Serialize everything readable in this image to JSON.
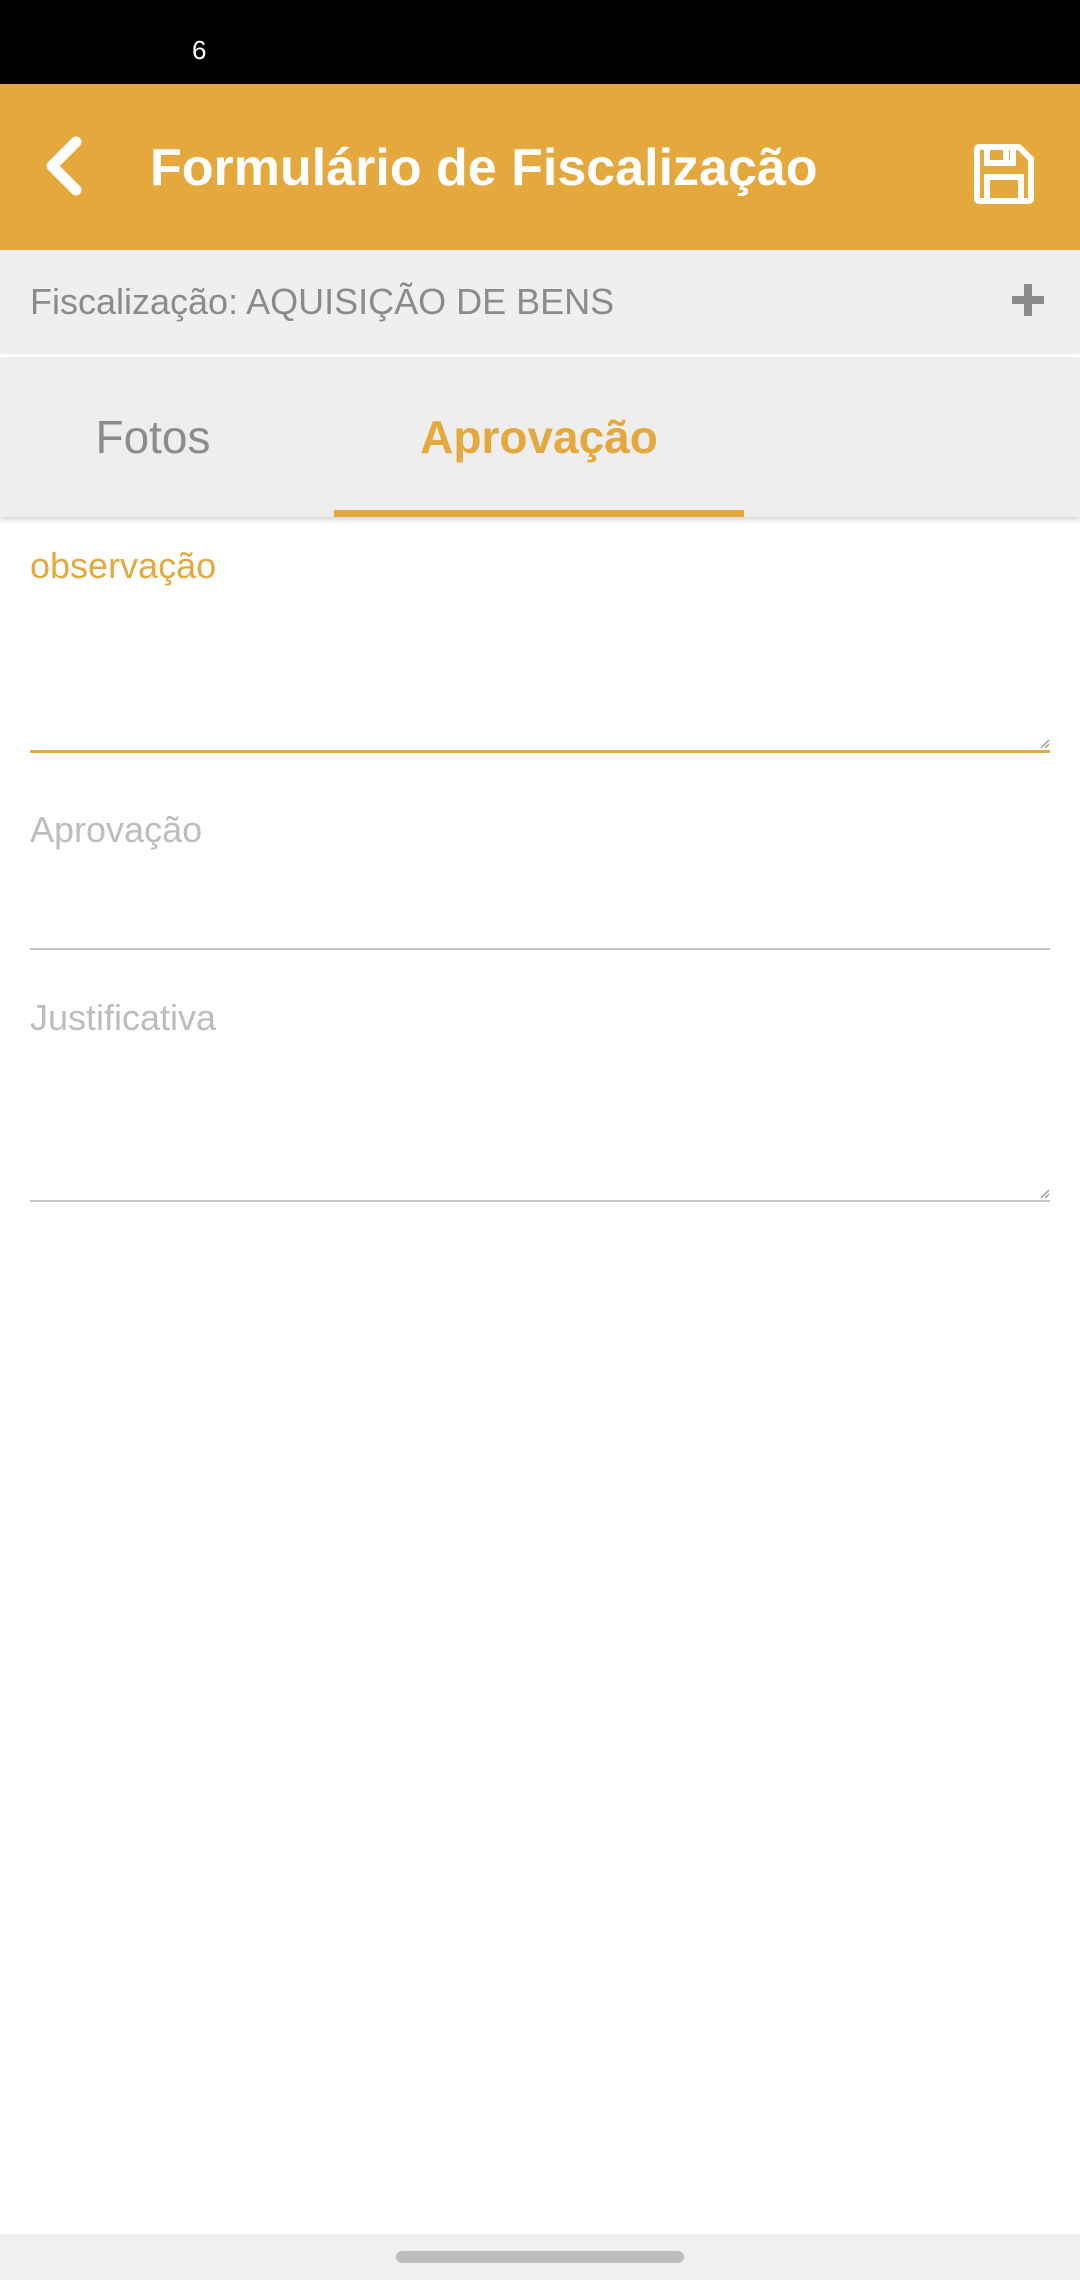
{
  "status_bar": {
    "time": "6"
  },
  "app_bar": {
    "title": "Formulário de Fiscalização",
    "back_icon": "chevron-left-icon",
    "save_icon": "floppy-disk-icon",
    "background_color": "#e5a83c"
  },
  "subheader": {
    "text": "Fiscalização: AQUISIÇÃO DE BENS",
    "add_icon": "plus-icon"
  },
  "tabs": [
    {
      "label": "Fotos",
      "selected": false
    },
    {
      "label": "Aprovação",
      "selected": true
    }
  ],
  "form": {
    "observacao_label": "observação",
    "aprovacao_label": "Aprovação",
    "justificativa_label": "Justificativa"
  },
  "colors": {
    "accent": "#e5a83c",
    "muted_text": "#8b8b8b",
    "placeholder_text": "#bdbdbd"
  }
}
